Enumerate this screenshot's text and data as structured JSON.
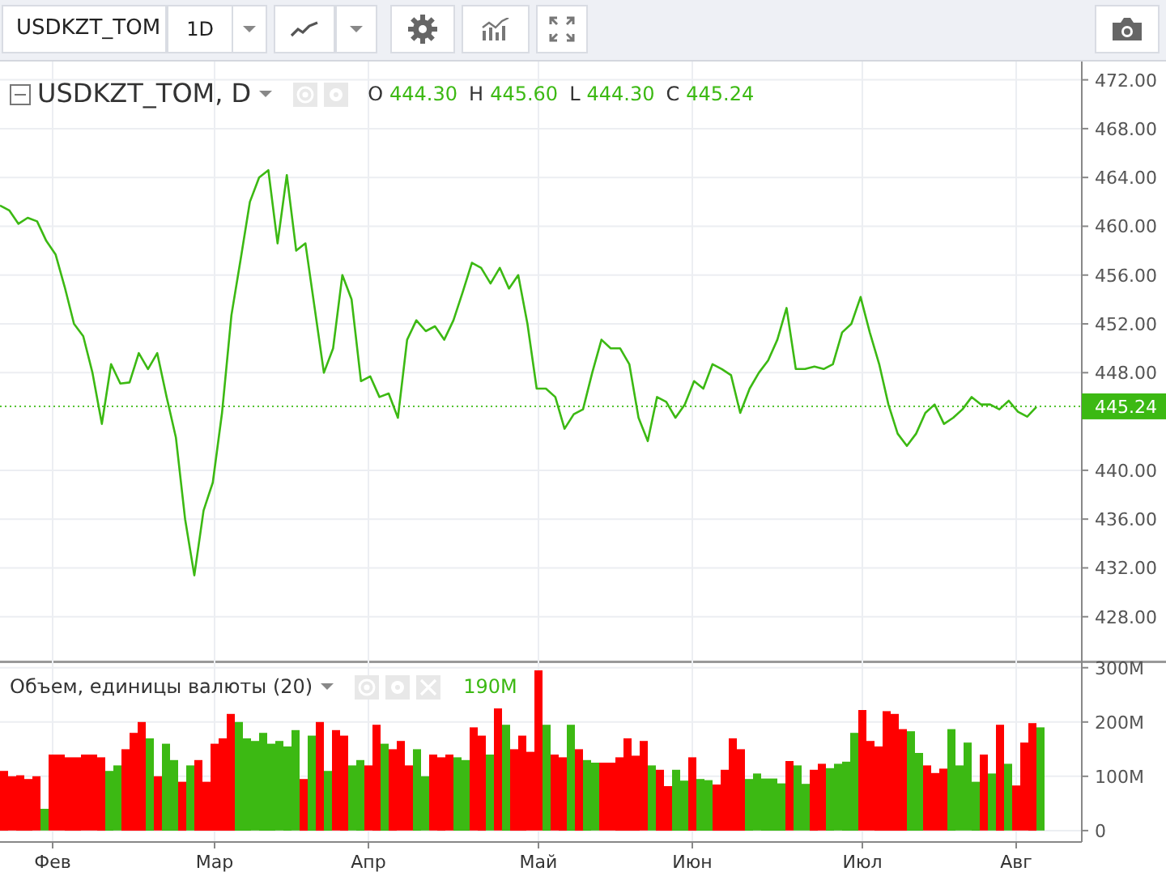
{
  "toolbar": {
    "symbol": "USDKZT_TOM",
    "interval": "1D"
  },
  "price_pane": {
    "symbol_title": "USDKZT_TOM, D",
    "ohlc": [
      {
        "label": "O",
        "value": "444.30"
      },
      {
        "label": "H",
        "value": "445.60"
      },
      {
        "label": "L",
        "value": "444.30"
      },
      {
        "label": "C",
        "value": "445.24"
      }
    ],
    "chart_data": {
      "type": "line",
      "grid": true,
      "ylim": [
        424.4,
        473.5
      ],
      "ref_lines": [
        {
          "axis": "y",
          "value": 445.24,
          "label": "445.24"
        }
      ],
      "yticks": [
        {
          "value": 472,
          "label": "472.00"
        },
        {
          "value": 468,
          "label": "468.00"
        },
        {
          "value": 464,
          "label": "464.00"
        },
        {
          "value": 460,
          "label": "460.00"
        },
        {
          "value": 456,
          "label": "456.00"
        },
        {
          "value": 452,
          "label": "452.00"
        },
        {
          "value": 448,
          "label": "448.00"
        },
        {
          "value": 440,
          "label": "440.00"
        },
        {
          "value": 436,
          "label": "436.00"
        },
        {
          "value": 432,
          "label": "432.00"
        },
        {
          "value": 428,
          "label": "428.00"
        }
      ],
      "series": [
        {
          "color": "#3cb913",
          "values": [
            461.7,
            461.3,
            460.2,
            460.7,
            460.4,
            458.8,
            457.7,
            455.0,
            452.0,
            451.0,
            448.0,
            443.8,
            448.7,
            447.1,
            447.2,
            449.6,
            448.3,
            449.6,
            446.0,
            442.7,
            436.0,
            431.4,
            436.7,
            439.0,
            444.7,
            452.7,
            457.3,
            462.0,
            464.0,
            464.6,
            458.6,
            464.2,
            458.0,
            458.6,
            453.3,
            448.0,
            450.0,
            456.0,
            454.0,
            447.3,
            447.7,
            446.0,
            446.3,
            444.3,
            450.7,
            452.3,
            451.4,
            451.8,
            450.7,
            452.3,
            454.6,
            457.0,
            456.6,
            455.3,
            456.6,
            454.9,
            456.0,
            452.0,
            446.7,
            446.7,
            446.0,
            443.4,
            444.6,
            445.0,
            448.0,
            450.7,
            450.0,
            450.0,
            448.7,
            444.3,
            442.4,
            446.0,
            445.6,
            444.3,
            445.4,
            447.3,
            446.7,
            448.7,
            448.3,
            447.8,
            444.7,
            446.7,
            448.0,
            449.0,
            450.7,
            453.3,
            448.3,
            448.3,
            448.5,
            448.3,
            448.7,
            451.3,
            452.0,
            454.2,
            451.3,
            448.7,
            445.4,
            443.0,
            442.0,
            443.0,
            444.7,
            445.4,
            443.8,
            444.3,
            445.0,
            446.0,
            445.4,
            445.4,
            445.0,
            445.7,
            444.8,
            444.4,
            445.2
          ]
        }
      ]
    }
  },
  "volume_pane": {
    "title": "Объем, единицы валюты (20)",
    "value": "190M",
    "chart_data": {
      "type": "bar",
      "grid": true,
      "ylim": [
        -21,
        313
      ],
      "categories": [
        null,
        null,
        null,
        null,
        null,
        null,
        "Фев",
        null,
        null,
        null,
        null,
        null,
        null,
        null,
        null,
        null,
        null,
        null,
        null,
        null,
        null,
        null,
        null,
        null,
        null,
        null,
        "Мар",
        null,
        null,
        null,
        null,
        null,
        null,
        null,
        null,
        null,
        null,
        null,
        null,
        null,
        null,
        null,
        null,
        null,
        null,
        "Апр",
        null,
        null,
        null,
        null,
        null,
        null,
        null,
        null,
        null,
        null,
        null,
        null,
        null,
        null,
        null,
        null,
        null,
        null,
        null,
        null,
        "Май",
        null,
        null,
        null,
        null,
        null,
        null,
        null,
        null,
        null,
        null,
        null,
        null,
        null,
        null,
        null,
        null,
        null,
        null,
        "Июн",
        null,
        null,
        null,
        null,
        null,
        null,
        null,
        null,
        null,
        null,
        null,
        null,
        null,
        null,
        null,
        null,
        null,
        null,
        null,
        null,
        "Июл",
        null,
        null,
        null,
        null,
        null,
        null,
        null,
        null,
        null,
        null,
        null,
        null,
        null,
        null,
        null,
        null,
        null,
        null,
        "Авг",
        null,
        null,
        null
      ],
      "yticks": [
        {
          "value": 0,
          "label": "0"
        },
        {
          "value": 100,
          "label": "100M"
        },
        {
          "value": 200,
          "label": "200M"
        },
        {
          "value": 300,
          "label": "300M"
        }
      ],
      "series": [
        {
          "color": "#3cb913",
          "values": [
            null,
            null,
            null,
            null,
            null,
            40,
            null,
            null,
            null,
            null,
            null,
            null,
            null,
            110,
            120,
            null,
            null,
            null,
            170,
            null,
            160,
            130,
            null,
            120,
            null,
            null,
            null,
            null,
            null,
            200,
            170,
            165,
            180,
            160,
            165,
            155,
            185,
            null,
            175,
            null,
            110,
            null,
            null,
            120,
            130,
            null,
            null,
            160,
            null,
            null,
            null,
            150,
            100,
            null,
            null,
            null,
            135,
            130,
            null,
            null,
            140,
            null,
            195,
            null,
            null,
            null,
            null,
            195,
            null,
            null,
            195,
            null,
            130,
            125,
            null,
            null,
            null,
            null,
            null,
            null,
            120,
            null,
            null,
            112,
            92,
            null,
            95,
            93,
            null,
            null,
            null,
            null,
            95,
            105,
            96,
            96,
            87,
            null,
            120,
            86,
            null,
            null,
            115,
            123,
            127,
            180,
            null,
            null,
            null,
            null,
            null,
            null,
            183,
            143,
            null,
            null,
            null,
            187,
            120,
            162,
            90,
            null,
            105,
            null,
            123,
            null,
            null,
            null,
            190
          ]
        },
        {
          "color": "#ff0000",
          "values": [
            110,
            100,
            102,
            95,
            100,
            null,
            140,
            140,
            135,
            135,
            140,
            140,
            135,
            null,
            null,
            150,
            180,
            200,
            null,
            100,
            null,
            null,
            90,
            null,
            130,
            90,
            160,
            170,
            215,
            null,
            null,
            null,
            null,
            null,
            null,
            null,
            null,
            95,
            null,
            200,
            null,
            185,
            175,
            null,
            null,
            120,
            195,
            null,
            150,
            165,
            120,
            null,
            null,
            140,
            135,
            140,
            null,
            null,
            190,
            175,
            null,
            225,
            null,
            150,
            175,
            145,
            295,
            null,
            140,
            135,
            null,
            150,
            null,
            null,
            125,
            125,
            135,
            170,
            138,
            165,
            null,
            112,
            82,
            null,
            null,
            135,
            null,
            null,
            85,
            112,
            170,
            150,
            null,
            null,
            null,
            null,
            null,
            128,
            null,
            null,
            112,
            123,
            null,
            null,
            null,
            null,
            222,
            165,
            155,
            220,
            215,
            187,
            null,
            null,
            120,
            106,
            114,
            null,
            null,
            null,
            null,
            140,
            null,
            195,
            null,
            83,
            162,
            198,
            null
          ]
        }
      ]
    }
  }
}
